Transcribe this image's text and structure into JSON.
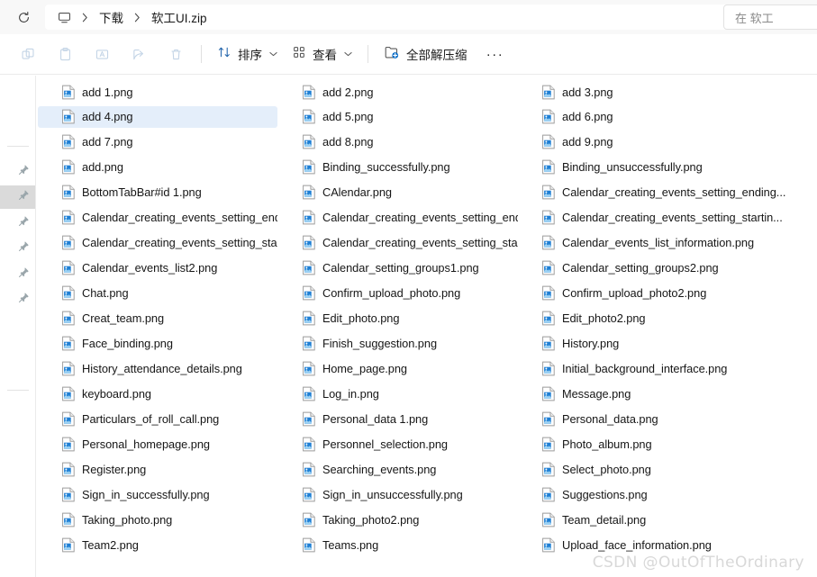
{
  "window": {
    "address_bar": {
      "refresh_icon": "refresh-icon",
      "pc_icon": "this-pc-monitor-icon",
      "separator": "›",
      "crumbs": [
        "下载",
        "软工UI.zip"
      ]
    },
    "search": {
      "icon": "search-icon",
      "placeholder": "在 软工UI.zip 中搜索",
      "visible_text": "在 软工"
    }
  },
  "command_bar": {
    "icon_buttons": [
      {
        "name": "copy-icon",
        "enabled": false
      },
      {
        "name": "paste-icon",
        "enabled": false
      },
      {
        "name": "rename-icon",
        "enabled": false
      },
      {
        "name": "share-icon",
        "enabled": false
      },
      {
        "name": "delete-icon",
        "enabled": false
      }
    ],
    "sort_label": "排序",
    "view_label": "查看",
    "extract_all_label": "全部解压缩",
    "extract_all_icon": "extract-folder-icon",
    "more_label": "···",
    "chevron": "⌄"
  },
  "nav_pane": {
    "items": [
      {
        "icon": "pin-icon",
        "selected": false
      },
      {
        "icon": "pin-icon",
        "selected": true
      },
      {
        "icon": "pin-icon",
        "selected": false
      },
      {
        "icon": "pin-icon",
        "selected": false
      },
      {
        "icon": "pin-icon",
        "selected": false
      },
      {
        "icon": "pin-icon",
        "selected": false
      }
    ]
  },
  "file_list": {
    "view_mode": "list",
    "selected_file": "add 4.png",
    "file_icon": "png-image-file-icon",
    "columns": [
      [
        "add 1.png",
        "add 4.png",
        "add 7.png",
        "add.png",
        "BottomTabBar#id 1.png",
        "Calendar_creating_events_setting_ending...",
        "Calendar_creating_events_setting_startin...",
        "Calendar_events_list2.png",
        "Chat.png",
        "Creat_team.png",
        "Face_binding.png",
        "History_attendance_details.png",
        "keyboard.png",
        "Particulars_of_roll_call.png",
        "Personal_homepage.png",
        "Register.png",
        "Sign_in_successfully.png",
        "Taking_photo.png",
        "Team2.png"
      ],
      [
        "add 2.png",
        "add 5.png",
        "add 8.png",
        "Binding_successfully.png",
        "CAlendar.png",
        "Calendar_creating_events_setting_ending...",
        "Calendar_creating_events_setting_startin...",
        "Calendar_setting_groups1.png",
        "Confirm_upload_photo.png",
        "Edit_photo.png",
        "Finish_suggestion.png",
        "Home_page.png",
        "Log_in.png",
        "Personal_data 1.png",
        "Personnel_selection.png",
        "Searching_events.png",
        "Sign_in_unsuccessfully.png",
        "Taking_photo2.png",
        "Teams.png"
      ],
      [
        "add 3.png",
        "add 6.png",
        "add 9.png",
        "Binding_unsuccessfully.png",
        "Calendar_creating_events_setting_ending...",
        "Calendar_creating_events_setting_startin...",
        "Calendar_events_list_information.png",
        "Calendar_setting_groups2.png",
        "Confirm_upload_photo2.png",
        "Edit_photo2.png",
        "History.png",
        "Initial_background_interface.png",
        "Message.png",
        "Personal_data.png",
        "Photo_album.png",
        "Select_photo.png",
        "Suggestions.png",
        "Team_detail.png",
        "Upload_face_information.png"
      ]
    ]
  },
  "watermark": "CSDN @OutOfTheOrdinary",
  "colors": {
    "selection": "#e4eefa",
    "accent": "#0b6ec8",
    "chrome": "#f8f8f8",
    "text": "#161616"
  }
}
